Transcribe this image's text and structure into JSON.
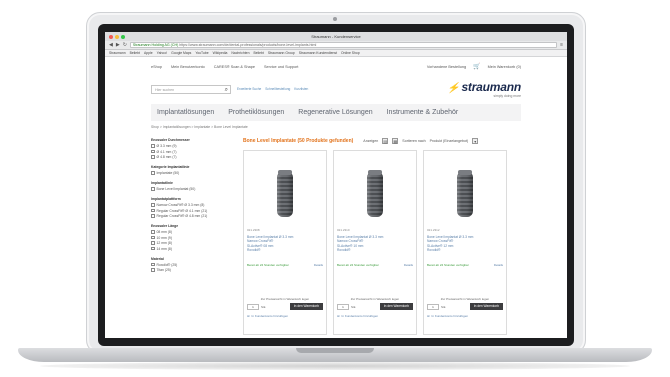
{
  "window": {
    "title": "Straumann - Kundenservice"
  },
  "browser": {
    "url_secure": "Straumann Holding AG (CH)",
    "url_rest": "https://www.straumann.com/de/dental-professionals/products/bone-level-implants.html",
    "bookmarks": [
      "Straumann",
      "Beliebt",
      "Apple",
      "Yahoo!",
      "Google Maps",
      "YouTube",
      "Wikipedia",
      "Nachrichten",
      "Beliebt",
      "Straumann Group",
      "Straumann Kundendienst",
      "Online Shop"
    ]
  },
  "topnav": {
    "items": [
      "eShop",
      "Mein Benutzerkonto",
      "CARES® Scan & Shape",
      "Service und Support"
    ],
    "right_items": [
      "Vorhandene Bestellung",
      "Mein Warenkorb (0)"
    ]
  },
  "search": {
    "placeholder": "Hier suchen",
    "links": [
      "Erweiterte Suche",
      "Schnellbestellung",
      "Kurzlisten"
    ]
  },
  "logo": {
    "brand": "straumann",
    "tagline": "simply doing more"
  },
  "mainnav": [
    "Implantatlösungen",
    "Prothetiklösungen",
    "Regenerative Lösungen",
    "Instrumente & Zubehör"
  ],
  "breadcrumb": "Shop > Implantatlösungen > Implantate > Bone Level Implantate",
  "sidebar": [
    {
      "heading": "Enossaler Durchmesser",
      "options": [
        "Ø 3.3 mm (9)",
        "Ø 4.1 mm (7)",
        "Ø 4.8 mm (7)"
      ]
    },
    {
      "heading": "Kategorie Implantatlinie",
      "options": [
        "Implantate (50)"
      ]
    },
    {
      "heading": "Implantatlinie",
      "options": [
        "Bone Level Implantat (50)"
      ]
    },
    {
      "heading": "Implantatplattform",
      "options": [
        "Narrow CrossFit® Ø 3.3 mm (8)",
        "Regular CrossFit® Ø 4.1 mm (21)",
        "Regular CrossFit® Ø 4.8 mm (21)"
      ]
    },
    {
      "heading": "Enossaler Länge",
      "options": [
        "08 mm (8)",
        "10 mm (9)",
        "12 mm (8)",
        "14 mm (8)"
      ]
    },
    {
      "heading": "Material",
      "options": [
        "Roxolid® (25)",
        "Titan (25)"
      ]
    }
  ],
  "results": {
    "title": "Bone Level Implantate (50 Produkte gefunden)",
    "anzeigen_label": "Anzeigen",
    "sort_label": "Sortieren nach",
    "sort_value": "Produkt (Einzelangebot)"
  },
  "products": [
    {
      "article": "021.2308",
      "name_lines": [
        "Bone Level Implantat Ø 3.3 mm",
        "Narrow CrossFit®",
        "SLActive® 08 mm",
        "Roxolid®"
      ],
      "stock": "Bereit ab 24 Stunden verfügbar",
      "details": "Details",
      "note": "Zur Preisansicht in Warenkorb legen",
      "qty": "1",
      "unit": "Stk.",
      "buy_label": "In den Warenkorb",
      "wish": "In Kundenkonto hinzufügen"
    },
    {
      "article": "021.2310",
      "name_lines": [
        "Bone Level Implantat Ø 3.3 mm",
        "Narrow CrossFit®",
        "SLActive® 10 mm",
        "Roxolid®"
      ],
      "stock": "Bereit ab 24 Stunden verfügbar",
      "details": "Details",
      "note": "Zur Preisansicht in Warenkorb legen",
      "qty": "1",
      "unit": "Stk.",
      "buy_label": "In den Warenkorb",
      "wish": "In Kundenkonto hinzufügen"
    },
    {
      "article": "021.2312",
      "name_lines": [
        "Bone Level Implantat Ø 3.3 mm",
        "Narrow CrossFit®",
        "SLActive® 12 mm",
        "Roxolid®"
      ],
      "stock": "Bereit ab 24 Stunden verfügbar",
      "details": "Details",
      "note": "Zur Preisansicht in Warenkorb legen",
      "qty": "1",
      "unit": "Stk.",
      "buy_label": "In den Warenkorb",
      "wish": "In Kundenkonto hinzufügen"
    }
  ],
  "colors": {
    "accent": "#e2731c",
    "brand": "#1b2a4e",
    "link": "#5a7fa8"
  }
}
